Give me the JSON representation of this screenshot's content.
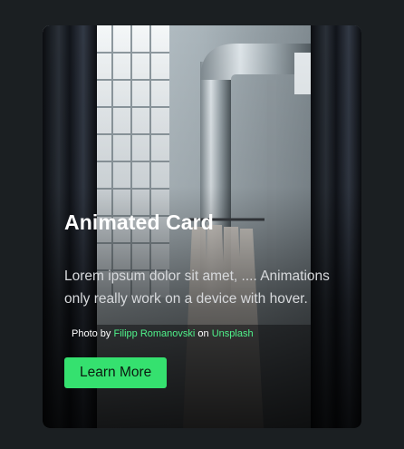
{
  "card": {
    "title": "Animated Card",
    "body": "Lorem ipsum dolor sit amet, .... Animations only really work on a device with hover.",
    "credit": {
      "prefix": "Photo by",
      "author": "Filipp Romanovski",
      "middle": "on",
      "source": "Unsplash"
    },
    "button_label": "Learn More"
  },
  "colors": {
    "page_background": "#1b1f22",
    "accent": "#35e16f",
    "link": "#4ff28a"
  }
}
